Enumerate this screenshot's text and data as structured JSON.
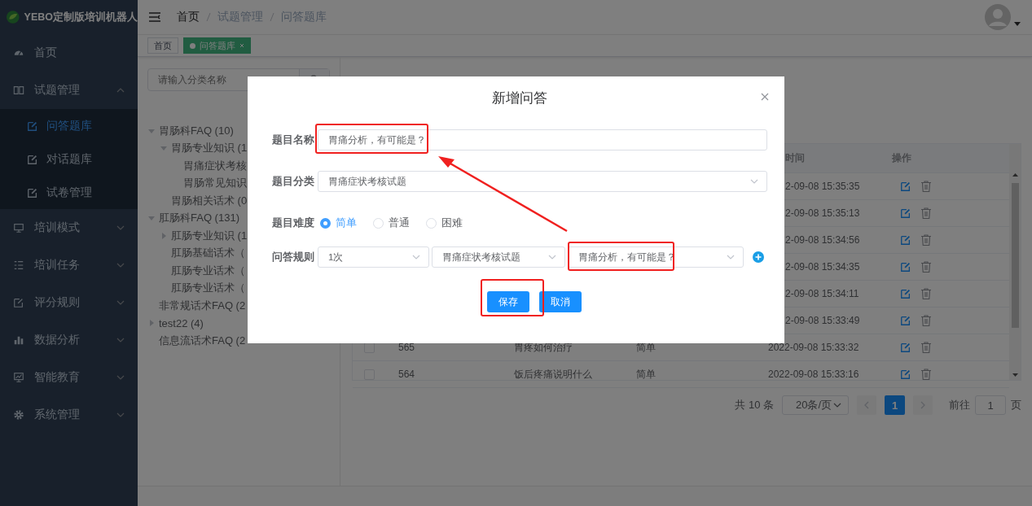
{
  "sidebar": {
    "title": "YEBO定制版培训机器人",
    "items": [
      {
        "label": "首页"
      },
      {
        "label": "试题管理",
        "expanded": true,
        "children": [
          {
            "label": "问答题库",
            "selected": true
          },
          {
            "label": "对话题库",
            "selected": false
          },
          {
            "label": "试卷管理",
            "selected": false
          }
        ]
      },
      {
        "label": "培训模式",
        "expanded": false
      },
      {
        "label": "培训任务",
        "expanded": false
      },
      {
        "label": "评分规则",
        "expanded": false
      },
      {
        "label": "数据分析",
        "expanded": false
      },
      {
        "label": "智能教育",
        "expanded": false
      },
      {
        "label": "系统管理",
        "expanded": false
      }
    ]
  },
  "header": {
    "breadcrumb": [
      "首页",
      "试题管理",
      "问答题库"
    ]
  },
  "tabs": [
    {
      "label": "首页",
      "selected": false
    },
    {
      "label": "问答题库",
      "selected": true
    }
  ],
  "category_search": {
    "placeholder": "请输入分类名称"
  },
  "tree": [
    {
      "label": "胃肠科FAQ (10)",
      "expanded": true,
      "children": [
        {
          "label": "胃肠专业知识 (1",
          "expanded": true,
          "children": [
            {
              "label": "胃痛症状考核"
            },
            {
              "label": "胃肠常见知识"
            }
          ]
        },
        {
          "label": "胃肠相关话术 (0"
        }
      ]
    },
    {
      "label": "肛肠科FAQ (131)",
      "expanded": true,
      "children": [
        {
          "label": "肛肠专业知识 (1",
          "expanded": false
        },
        {
          "label": "肛肠基础话术（"
        },
        {
          "label": "肛肠专业话术（"
        },
        {
          "label": "肛肠专业话术（"
        }
      ]
    },
    {
      "label": "非常规话术FAQ (2"
    },
    {
      "label": "test22 (4)",
      "expanded": false
    },
    {
      "label": "信息流话术FAQ (2"
    }
  ],
  "table": {
    "columns": [
      "时间",
      "操作"
    ],
    "rows": [
      {
        "time": "2-09-08 15:35:35"
      },
      {
        "time": "2-09-08 15:35:13"
      },
      {
        "time": "2-09-08 15:34:56"
      },
      {
        "time": "2-09-08 15:34:35"
      },
      {
        "time": "2-09-08 15:34:11"
      },
      {
        "time": "2-09-08 15:33:49"
      },
      {
        "checked": false,
        "id": "565",
        "title": "胃疼如何治疗",
        "difficulty": "简单",
        "time": "2022-09-08 15:33:32"
      },
      {
        "checked": false,
        "id": "564",
        "title": "饭后疼痛说明什么",
        "difficulty": "简单",
        "time": "2022-09-08 15:33:16"
      }
    ]
  },
  "pagination": {
    "total": "共 10 条",
    "page_size": "20条/页",
    "pages": [
      {
        "label": "1",
        "selected": true
      }
    ],
    "goto_label": "前往",
    "goto_value": "1",
    "goto_suffix": "页"
  },
  "dialog": {
    "title": "新增问答",
    "fields": [
      {
        "kind": "input",
        "label": "题目名称",
        "value": "胃痛分析，有可能是？"
      },
      {
        "kind": "select",
        "label": "题目分类",
        "value": "胃痛症状考核试题"
      },
      {
        "kind": "radio",
        "label": "题目难度",
        "options": [
          {
            "label": "简单",
            "selected": true
          },
          {
            "label": "普通",
            "selected": false
          },
          {
            "label": "困难",
            "selected": false
          }
        ]
      },
      {
        "kind": "rule",
        "label": "问答规则",
        "selects": [
          "1次",
          "胃痛症状考核试题",
          "胃痛分析，有可能是？"
        ]
      }
    ],
    "buttons": [
      "保存",
      "取消"
    ]
  }
}
